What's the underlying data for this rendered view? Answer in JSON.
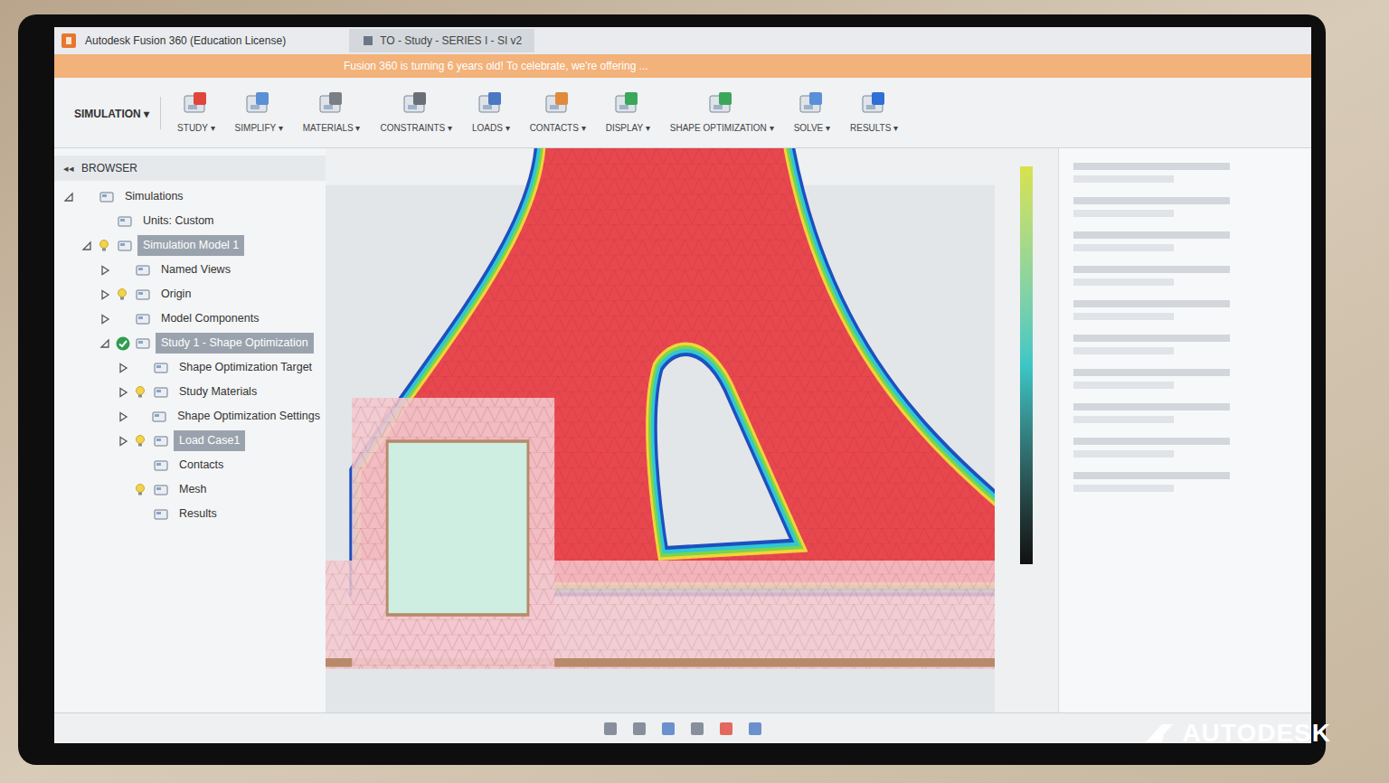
{
  "window": {
    "title": "Autodesk Fusion 360 (Education License)"
  },
  "document_tab": {
    "label": "TO - Study - SERIES I - SI v2"
  },
  "banner": {
    "text": "Fusion 360 is turning 6 years old! To celebrate, we're offering ..."
  },
  "workspace": {
    "label": "SIMULATION ▾"
  },
  "toolbar": [
    {
      "label": "STUDY ▾",
      "color": "#e0463a"
    },
    {
      "label": "SIMPLIFY ▾",
      "color": "#5b8fd6"
    },
    {
      "label": "MATERIALS ▾",
      "color": "#7a7f86"
    },
    {
      "label": "CONSTRAINTS ▾",
      "color": "#6a6f76"
    },
    {
      "label": "LOADS ▾",
      "color": "#4a78c2"
    },
    {
      "label": "CONTACTS ▾",
      "color": "#e08a3a"
    },
    {
      "label": "DISPLAY ▾",
      "color": "#3ca65a"
    },
    {
      "label": "SHAPE OPTIMIZATION ▾",
      "color": "#3ca65a"
    },
    {
      "label": "SOLVE ▾",
      "color": "#5b8fd6"
    },
    {
      "label": "RESULTS ▾",
      "color": "#2f6fd6"
    }
  ],
  "browser": {
    "collapse": "◂◂",
    "title": "BROWSER",
    "items": [
      {
        "label": "Simulations",
        "depth": 0,
        "has_children": true,
        "expanded": true,
        "selected": false,
        "checked": false,
        "bulb": false
      },
      {
        "label": "Units: Custom",
        "depth": 1,
        "has_children": false,
        "expanded": false,
        "selected": false,
        "checked": false,
        "bulb": false
      },
      {
        "label": "Simulation Model 1",
        "depth": 1,
        "has_children": true,
        "expanded": true,
        "selected": true,
        "checked": false,
        "bulb": true
      },
      {
        "label": "Named Views",
        "depth": 2,
        "has_children": true,
        "expanded": false,
        "selected": false,
        "checked": false,
        "bulb": false
      },
      {
        "label": "Origin",
        "depth": 2,
        "has_children": true,
        "expanded": false,
        "selected": false,
        "checked": false,
        "bulb": true
      },
      {
        "label": "Model Components",
        "depth": 2,
        "has_children": true,
        "expanded": false,
        "selected": false,
        "checked": false,
        "bulb": false
      },
      {
        "label": "Study 1 - Shape Optimization",
        "depth": 2,
        "has_children": true,
        "expanded": true,
        "selected": true,
        "checked": true,
        "bulb": false
      },
      {
        "label": "Shape Optimization Target",
        "depth": 3,
        "has_children": true,
        "expanded": false,
        "selected": false,
        "checked": false,
        "bulb": false
      },
      {
        "label": "Study Materials",
        "depth": 3,
        "has_children": true,
        "expanded": false,
        "selected": false,
        "checked": false,
        "bulb": true
      },
      {
        "label": "Shape Optimization Settings",
        "depth": 3,
        "has_children": true,
        "expanded": false,
        "selected": false,
        "checked": false,
        "bulb": false
      },
      {
        "label": "Load Case1",
        "depth": 3,
        "has_children": true,
        "expanded": false,
        "selected": true,
        "checked": false,
        "bulb": true
      },
      {
        "label": "Contacts",
        "depth": 3,
        "has_children": false,
        "expanded": false,
        "selected": false,
        "checked": false,
        "bulb": false
      },
      {
        "label": "Mesh",
        "depth": 3,
        "has_children": false,
        "expanded": false,
        "selected": false,
        "checked": false,
        "bulb": true
      },
      {
        "label": "Results",
        "depth": 3,
        "has_children": false,
        "expanded": false,
        "selected": false,
        "checked": false,
        "bulb": false
      }
    ]
  },
  "watermark": "AUTODESK"
}
